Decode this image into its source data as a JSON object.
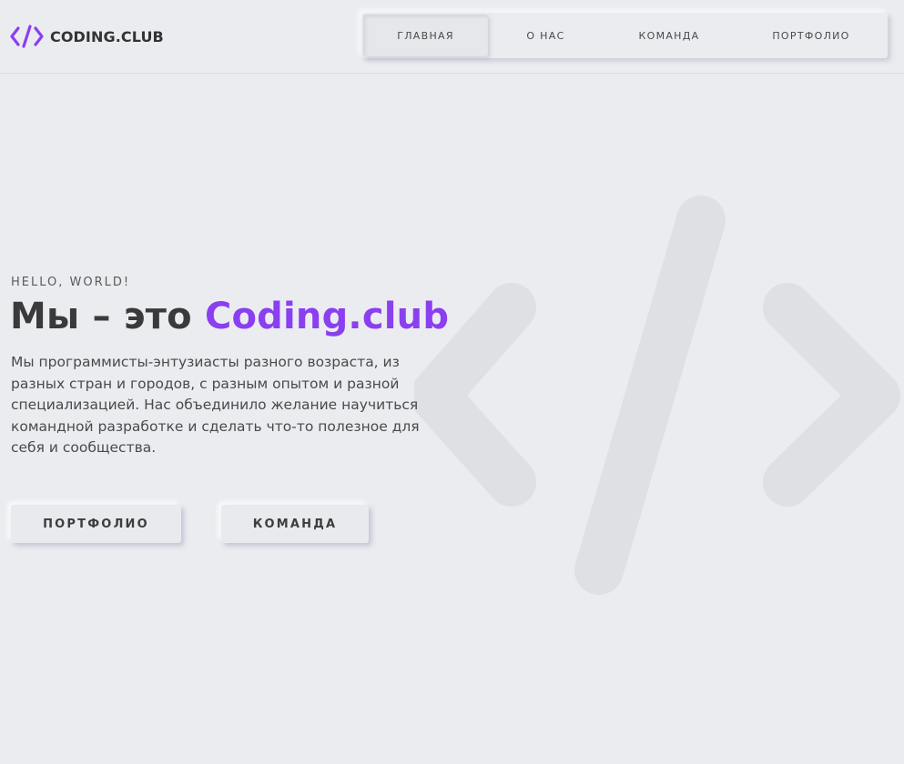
{
  "brand": {
    "name": "CODING.CLUB",
    "icon": "code-brackets-icon",
    "accent_color": "#8a3ff0"
  },
  "nav": {
    "items": [
      {
        "label": "ГЛАВНАЯ",
        "active": true
      },
      {
        "label": "О НАС",
        "active": false
      },
      {
        "label": "КОМАНДА",
        "active": false
      },
      {
        "label": "ПОРТФОЛИО",
        "active": false
      }
    ]
  },
  "hero": {
    "eyebrow": "HELLO, WORLD!",
    "headline_prefix": "Мы – это ",
    "headline_accent": "Coding.club",
    "description": "Мы программисты-энтузиасты разного возраста, из разных стран и городов, с разным опытом и разной специализацией. Нас объединило желание научиться командной разработке и сделать что-то полезное для себя и сообщества.",
    "buttons": {
      "portfolio": "ПОРТФОЛИО",
      "team": "КОМАНДА"
    },
    "background_icon": "code-brackets-icon"
  },
  "colors": {
    "background": "#ebecf0",
    "text": "#3a3a3a",
    "accent": "#8a3ff0"
  }
}
